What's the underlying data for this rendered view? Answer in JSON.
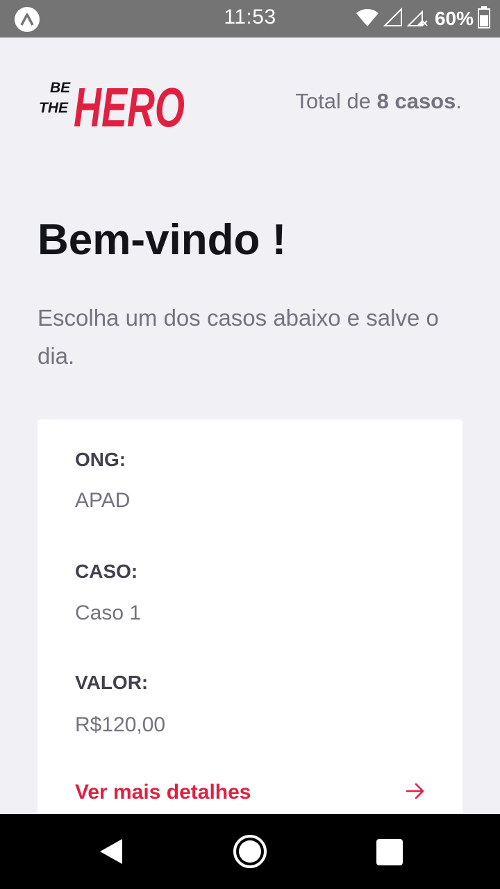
{
  "status_bar": {
    "time": "11:53",
    "battery": "60%",
    "icons": [
      "app-notification-icon",
      "wifi-icon",
      "cell-signal-icon",
      "cell-signal-off-icon",
      "battery-icon"
    ]
  },
  "header": {
    "logo_line1": "BE",
    "logo_line2": "THE",
    "logo_word": "HERO",
    "total_prefix": "Total de ",
    "total_count": "8 casos",
    "total_suffix": "."
  },
  "welcome": {
    "title": "Bem-vindo !",
    "description": "Escolha um dos casos abaixo e salve o dia."
  },
  "incident": {
    "ong_label": "ONG:",
    "ong_value": "APAD",
    "case_label": "CASO:",
    "case_value": "Caso 1",
    "value_label": "VALOR:",
    "value_value": "R$120,00",
    "details_label": "Ver mais detalhes"
  },
  "colors": {
    "brand": "#e02041",
    "background": "#f0f0f5",
    "title": "#13131a",
    "text_muted": "#737380"
  }
}
